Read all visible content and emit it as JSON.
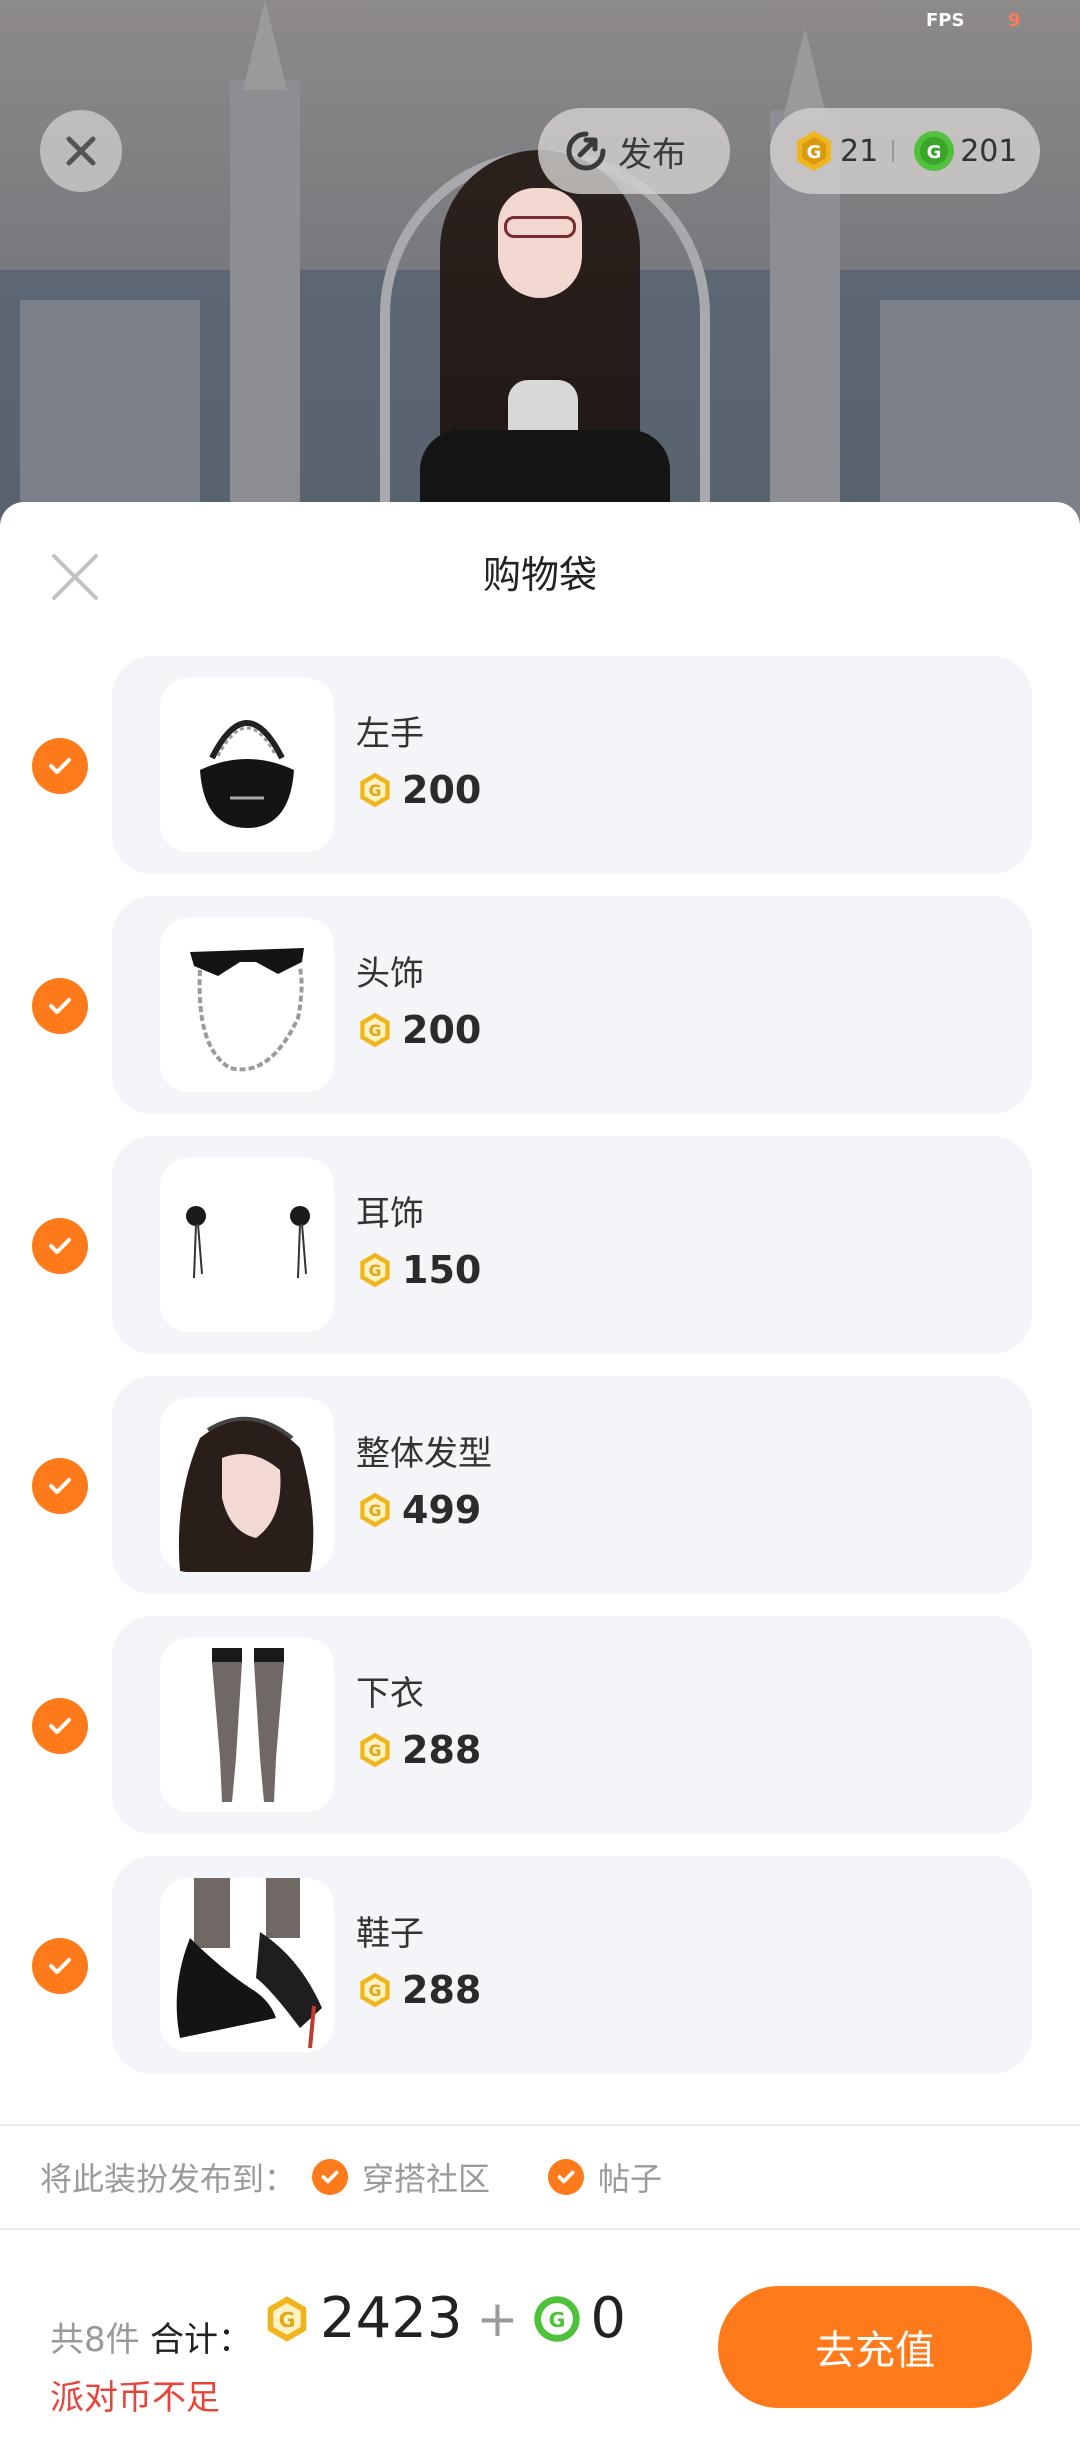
{
  "status": {
    "fps_label": "FPS",
    "fps_value": "9"
  },
  "header": {
    "publish_label": "发布",
    "gold_coins": "21",
    "green_coins": "201"
  },
  "sheet": {
    "title": "购物袋",
    "items": [
      {
        "name": "左手",
        "price": "200",
        "icon": "black-handbag-icon",
        "checked": true
      },
      {
        "name": "头饰",
        "price": "200",
        "icon": "sunglasses-chain-icon",
        "checked": true
      },
      {
        "name": "耳饰",
        "price": "150",
        "icon": "earrings-icon",
        "checked": true
      },
      {
        "name": "整体发型",
        "price": "499",
        "icon": "hairstyle-icon",
        "checked": true
      },
      {
        "name": "下衣",
        "price": "288",
        "icon": "stockings-icon",
        "checked": true
      },
      {
        "name": "鞋子",
        "price": "288",
        "icon": "heels-icon",
        "checked": true
      }
    ]
  },
  "publish": {
    "label": "将此装扮发布到：",
    "option1": "穿搭社区",
    "option2": "帖子"
  },
  "footer": {
    "count": "共8件",
    "total_label": "合计：",
    "gold_total": "2423",
    "plus": "+",
    "green_total": "0",
    "warning": "派对币不足",
    "recharge_button": "去充值"
  },
  "colors": {
    "accent": "#ff7a1a",
    "warning": "#e8453a",
    "gold": "#f0b51e",
    "green": "#4fc23c"
  }
}
